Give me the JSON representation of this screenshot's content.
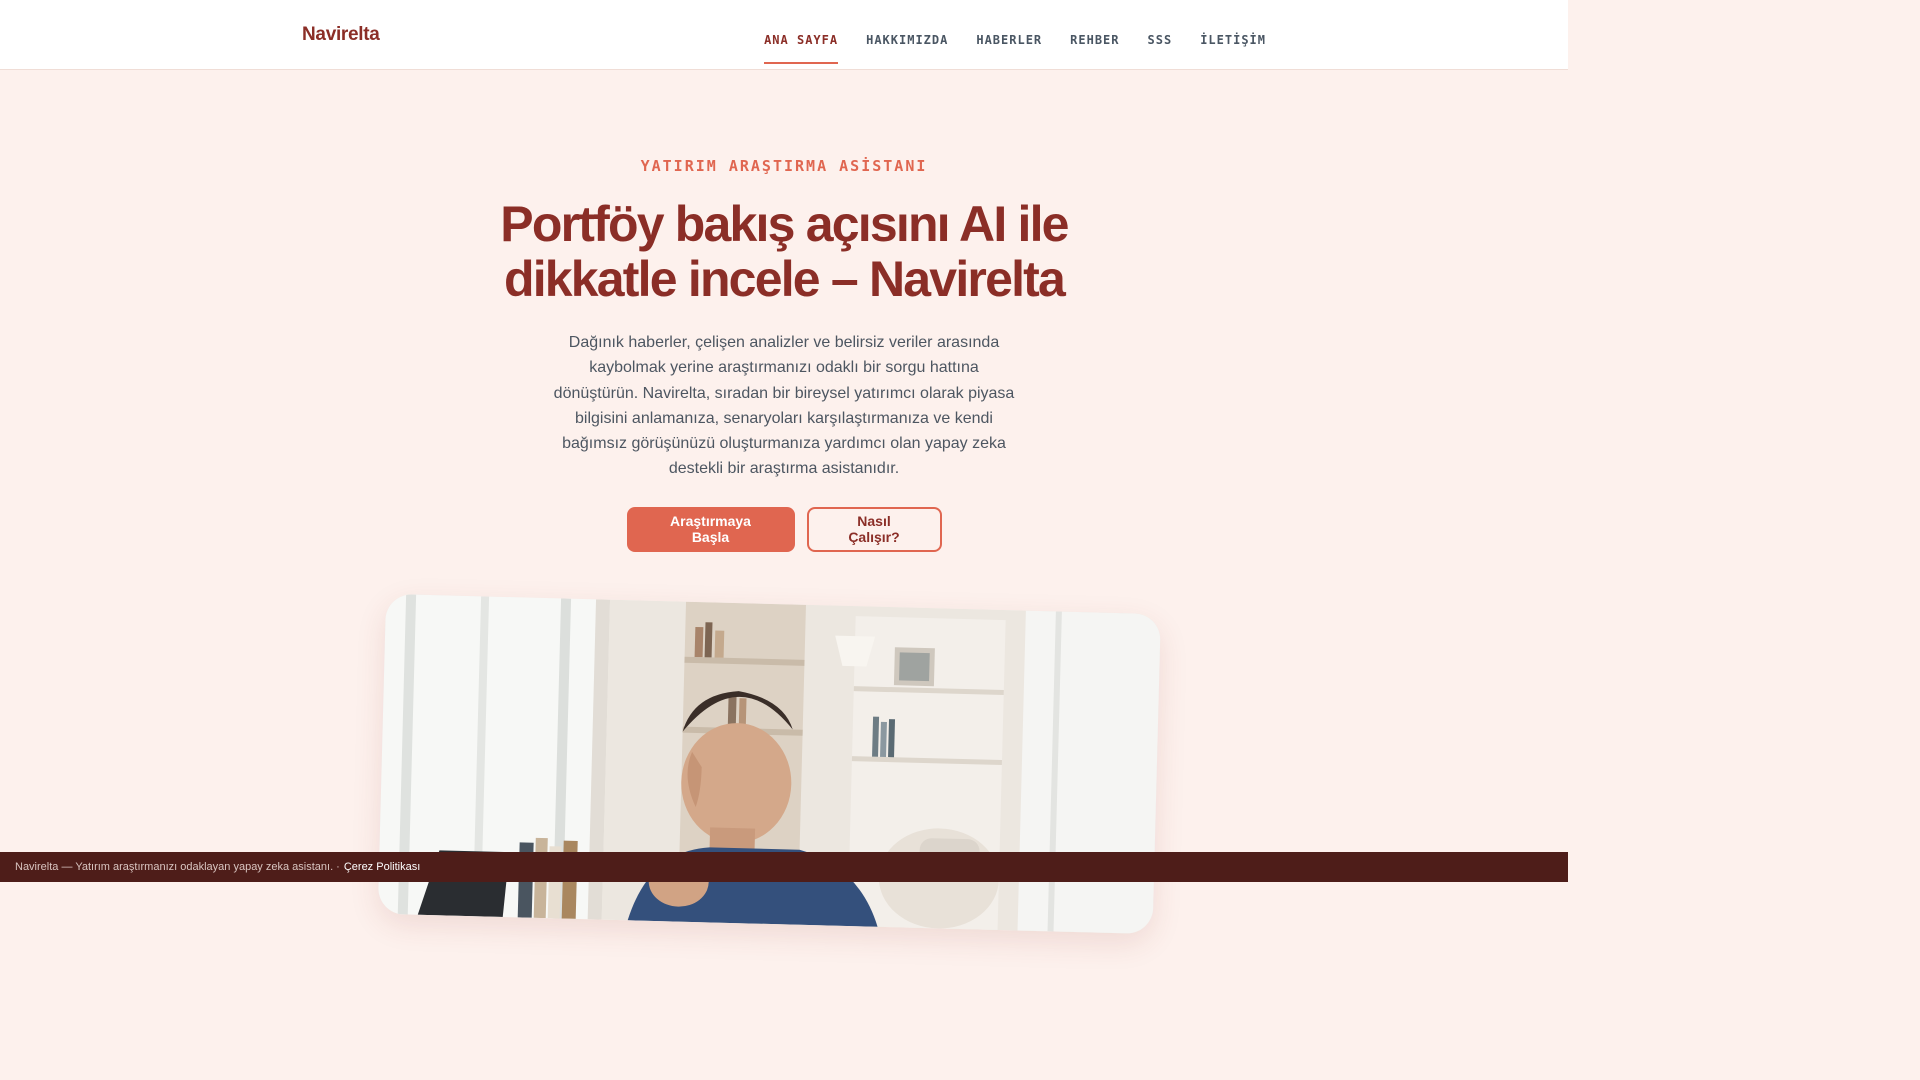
{
  "brand": {
    "name": "Navirelta"
  },
  "nav": {
    "items": [
      {
        "label": "ANA SAYFA",
        "active": true
      },
      {
        "label": "HAKKIMIZDA",
        "active": false
      },
      {
        "label": "HABERLER",
        "active": false
      },
      {
        "label": "REHBER",
        "active": false
      },
      {
        "label": "SSS",
        "active": false
      },
      {
        "label": "İLETİŞİM",
        "active": false
      }
    ]
  },
  "hero": {
    "eyebrow": "YATIRIM ARAŞTIRMA ASİSTANI",
    "title": "Portföy bakış açısını AI ile dikkatle incele – Navirelta",
    "lead": "Dağınık haberler, çelişen analizler ve belirsiz veriler arasında kaybolmak yerine araştırmanızı odaklı bir sorgu hattına dönüştürün. Navirelta, sıradan bir bireysel yatırımcı olarak piyasa bilgisini anlamanıza, senaryoları karşılaştırmanıza ve kendi bağımsız görüşünüzü oluşturmanıza yardımcı olan yapay zeka destekli bir araştırma asistanıdır.",
    "primary_button": "Araştırmaya Başla",
    "secondary_button": "Nasıl Çalışır?"
  },
  "footer": {
    "text": "Navirelta — Yatırım araştırmanızı odaklayan yapay zeka asistanı. ·",
    "link": "Çerez Politikası"
  },
  "colors": {
    "brand_dark": "#8b2e27",
    "accent": "#e06650",
    "background": "#fdf1ed",
    "footer_bg": "#4e1d19"
  }
}
